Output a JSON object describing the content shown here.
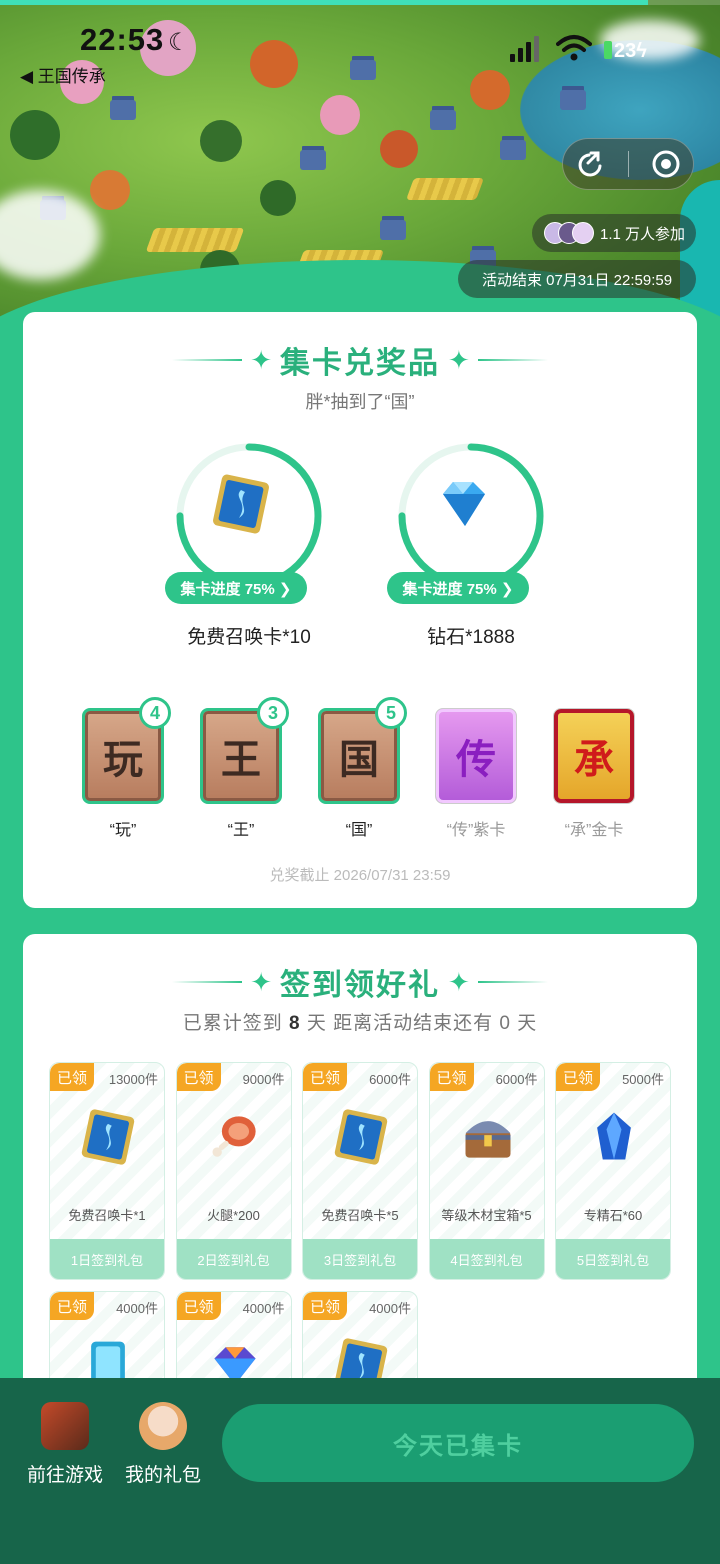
{
  "status": {
    "time": "22:53",
    "battery": "23"
  },
  "nav": {
    "back_label": "◀ 王国传承"
  },
  "hero": {
    "participants": "1.1 万人参加",
    "end_time": "活动结束 07月31日 22:59:59"
  },
  "exchange": {
    "title": "集卡兑奖品",
    "subtitle": "胖*抽到了“国”",
    "prizes": [
      {
        "name": "免费召唤卡*10",
        "progress_label": "集卡进度 75% ❯",
        "progress": 0.75,
        "icon": "summon-card-icon"
      },
      {
        "name": "钻石*1888",
        "progress_label": "集卡进度 75% ❯",
        "progress": 0.75,
        "icon": "diamond-icon"
      }
    ],
    "cards": [
      {
        "char": "玩",
        "label": "“玩”",
        "count": "4"
      },
      {
        "char": "王",
        "label": "“王”",
        "count": "3"
      },
      {
        "char": "国",
        "label": "“国”",
        "count": "5"
      },
      {
        "char": "传",
        "label": "“传”紫卡"
      },
      {
        "char": "承",
        "label": "“承”金卡"
      }
    ],
    "deadline": "兑奖截止 2026/07/31 23:59"
  },
  "signin": {
    "title": "签到领好礼",
    "sub_prefix": "已累计签到 ",
    "sub_days": "8",
    "sub_suffix": " 天  距离活动结束还有 0 天",
    "claimed_tag": "已领",
    "gifts": [
      {
        "qty": "13000件",
        "name": "免费召唤卡*1",
        "foot": "1日签到礼包",
        "icon": "summon-card-icon"
      },
      {
        "qty": "9000件",
        "name": "火腿*200",
        "foot": "2日签到礼包",
        "icon": "ham-icon"
      },
      {
        "qty": "6000件",
        "name": "免费召唤卡*5",
        "foot": "3日签到礼包",
        "icon": "summon-card-icon"
      },
      {
        "qty": "6000件",
        "name": "等级木材宝箱*5",
        "foot": "4日签到礼包",
        "icon": "treasure-chest-icon"
      },
      {
        "qty": "5000件",
        "name": "专精石*60",
        "foot": "5日签到礼包",
        "icon": "blue-stone-icon"
      },
      {
        "qty": "4000件",
        "icon": "crystal-card-icon"
      },
      {
        "qty": "4000件",
        "icon": "gem-icon"
      },
      {
        "qty": "4000件",
        "icon": "summon-card-icon"
      }
    ]
  },
  "bottom": {
    "go_game": "前往游戏",
    "my_gifts": "我的礼包",
    "main_button": "今天已集卡"
  },
  "colors": {
    "accent": "#2ec48a",
    "bottom_bar": "#17654a",
    "tag": "#f5a623"
  }
}
